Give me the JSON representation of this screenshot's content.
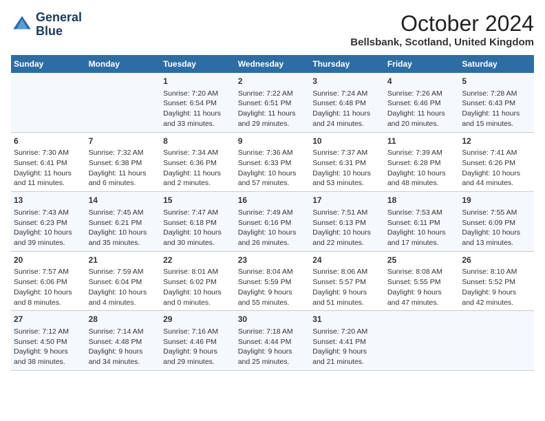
{
  "header": {
    "logo_line1": "General",
    "logo_line2": "Blue",
    "month": "October 2024",
    "location": "Bellsbank, Scotland, United Kingdom"
  },
  "days_of_week": [
    "Sunday",
    "Monday",
    "Tuesday",
    "Wednesday",
    "Thursday",
    "Friday",
    "Saturday"
  ],
  "weeks": [
    [
      {
        "day": "",
        "info": ""
      },
      {
        "day": "",
        "info": ""
      },
      {
        "day": "1",
        "info": "Sunrise: 7:20 AM\nSunset: 6:54 PM\nDaylight: 11 hours\nand 33 minutes."
      },
      {
        "day": "2",
        "info": "Sunrise: 7:22 AM\nSunset: 6:51 PM\nDaylight: 11 hours\nand 29 minutes."
      },
      {
        "day": "3",
        "info": "Sunrise: 7:24 AM\nSunset: 6:48 PM\nDaylight: 11 hours\nand 24 minutes."
      },
      {
        "day": "4",
        "info": "Sunrise: 7:26 AM\nSunset: 6:46 PM\nDaylight: 11 hours\nand 20 minutes."
      },
      {
        "day": "5",
        "info": "Sunrise: 7:28 AM\nSunset: 6:43 PM\nDaylight: 11 hours\nand 15 minutes."
      }
    ],
    [
      {
        "day": "6",
        "info": "Sunrise: 7:30 AM\nSunset: 6:41 PM\nDaylight: 11 hours\nand 11 minutes."
      },
      {
        "day": "7",
        "info": "Sunrise: 7:32 AM\nSunset: 6:38 PM\nDaylight: 11 hours\nand 6 minutes."
      },
      {
        "day": "8",
        "info": "Sunrise: 7:34 AM\nSunset: 6:36 PM\nDaylight: 11 hours\nand 2 minutes."
      },
      {
        "day": "9",
        "info": "Sunrise: 7:36 AM\nSunset: 6:33 PM\nDaylight: 10 hours\nand 57 minutes."
      },
      {
        "day": "10",
        "info": "Sunrise: 7:37 AM\nSunset: 6:31 PM\nDaylight: 10 hours\nand 53 minutes."
      },
      {
        "day": "11",
        "info": "Sunrise: 7:39 AM\nSunset: 6:28 PM\nDaylight: 10 hours\nand 48 minutes."
      },
      {
        "day": "12",
        "info": "Sunrise: 7:41 AM\nSunset: 6:26 PM\nDaylight: 10 hours\nand 44 minutes."
      }
    ],
    [
      {
        "day": "13",
        "info": "Sunrise: 7:43 AM\nSunset: 6:23 PM\nDaylight: 10 hours\nand 39 minutes."
      },
      {
        "day": "14",
        "info": "Sunrise: 7:45 AM\nSunset: 6:21 PM\nDaylight: 10 hours\nand 35 minutes."
      },
      {
        "day": "15",
        "info": "Sunrise: 7:47 AM\nSunset: 6:18 PM\nDaylight: 10 hours\nand 30 minutes."
      },
      {
        "day": "16",
        "info": "Sunrise: 7:49 AM\nSunset: 6:16 PM\nDaylight: 10 hours\nand 26 minutes."
      },
      {
        "day": "17",
        "info": "Sunrise: 7:51 AM\nSunset: 6:13 PM\nDaylight: 10 hours\nand 22 minutes."
      },
      {
        "day": "18",
        "info": "Sunrise: 7:53 AM\nSunset: 6:11 PM\nDaylight: 10 hours\nand 17 minutes."
      },
      {
        "day": "19",
        "info": "Sunrise: 7:55 AM\nSunset: 6:09 PM\nDaylight: 10 hours\nand 13 minutes."
      }
    ],
    [
      {
        "day": "20",
        "info": "Sunrise: 7:57 AM\nSunset: 6:06 PM\nDaylight: 10 hours\nand 8 minutes."
      },
      {
        "day": "21",
        "info": "Sunrise: 7:59 AM\nSunset: 6:04 PM\nDaylight: 10 hours\nand 4 minutes."
      },
      {
        "day": "22",
        "info": "Sunrise: 8:01 AM\nSunset: 6:02 PM\nDaylight: 10 hours\nand 0 minutes."
      },
      {
        "day": "23",
        "info": "Sunrise: 8:04 AM\nSunset: 5:59 PM\nDaylight: 9 hours\nand 55 minutes."
      },
      {
        "day": "24",
        "info": "Sunrise: 8:06 AM\nSunset: 5:57 PM\nDaylight: 9 hours\nand 51 minutes."
      },
      {
        "day": "25",
        "info": "Sunrise: 8:08 AM\nSunset: 5:55 PM\nDaylight: 9 hours\nand 47 minutes."
      },
      {
        "day": "26",
        "info": "Sunrise: 8:10 AM\nSunset: 5:52 PM\nDaylight: 9 hours\nand 42 minutes."
      }
    ],
    [
      {
        "day": "27",
        "info": "Sunrise: 7:12 AM\nSunset: 4:50 PM\nDaylight: 9 hours\nand 38 minutes."
      },
      {
        "day": "28",
        "info": "Sunrise: 7:14 AM\nSunset: 4:48 PM\nDaylight: 9 hours\nand 34 minutes."
      },
      {
        "day": "29",
        "info": "Sunrise: 7:16 AM\nSunset: 4:46 PM\nDaylight: 9 hours\nand 29 minutes."
      },
      {
        "day": "30",
        "info": "Sunrise: 7:18 AM\nSunset: 4:44 PM\nDaylight: 9 hours\nand 25 minutes."
      },
      {
        "day": "31",
        "info": "Sunrise: 7:20 AM\nSunset: 4:41 PM\nDaylight: 9 hours\nand 21 minutes."
      },
      {
        "day": "",
        "info": ""
      },
      {
        "day": "",
        "info": ""
      }
    ]
  ]
}
